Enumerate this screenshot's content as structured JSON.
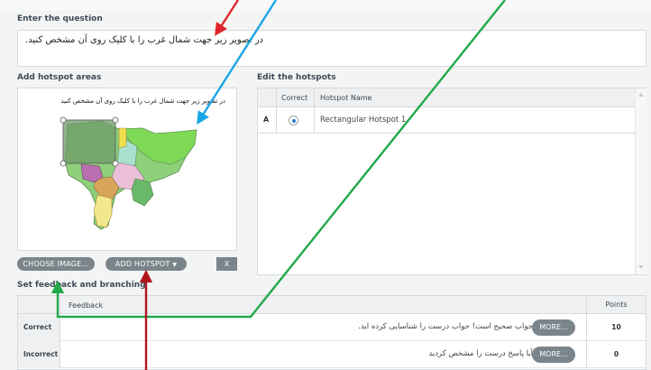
{
  "question": {
    "label": "Enter the question",
    "text": "در تصویر زیر جهت شمال غرب را با کلیک روی آن مشخص کنید."
  },
  "hotspot_areas": {
    "label": "Add hotspot areas",
    "image_caption": "در تصویر زیر جهت شمال غرب را با کلیک روی آن مشخص کنید"
  },
  "hotspots": {
    "label": "Edit the hotspots",
    "columns": [
      "Correct",
      "Hotspot Name"
    ],
    "rows": [
      {
        "letter": "A",
        "correct": true,
        "name": "Rectangular Hotspot 1"
      }
    ]
  },
  "buttons": {
    "choose_image": "CHOOSE IMAGE...",
    "add_hotspot": "ADD HOTSPOT",
    "delete": "X"
  },
  "feedback": {
    "label": "Set feedback and branching",
    "columns": [
      "Feedback",
      "Points"
    ],
    "rows": [
      {
        "label": "Correct",
        "text": "جواب صحیح است! جواب درست را شناسایی کرده اید.",
        "more": "MORE...",
        "points": "10"
      },
      {
        "label": "Incorrect",
        "text": "آیا پاسخ درست را مشخص کردید",
        "more": "MORE...",
        "points": "0"
      }
    ]
  },
  "colors": {
    "button_gray": "#7a848b",
    "arrow_red": "#e0262a",
    "arrow_blue": "#1aa7e6",
    "arrow_green": "#23a84a",
    "arrow_darkred": "#b3141c",
    "hotspot_fill": "#6d9a6a",
    "radio_blue": "#2a7fd8"
  }
}
